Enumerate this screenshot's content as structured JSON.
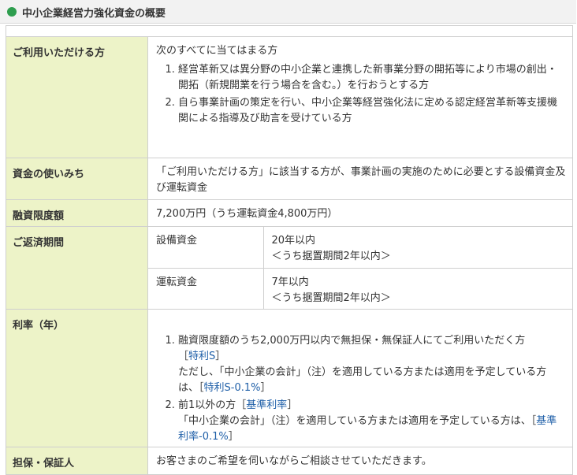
{
  "header": {
    "title": "中小企業経営力強化資金の概要"
  },
  "rows": {
    "eligibility": {
      "label": "ご利用いただける方",
      "intro": "次のすべてに当てはまる方",
      "items": [
        "経営革新又は異分野の中小企業と連携した新事業分野の開拓等により市場の創出・開拓（新規開業を行う場合を含む。）を行おうとする方",
        "自ら事業計画の策定を行い、中小企業等経営強化法に定める認定経営革新等支援機関による指導及び助言を受けている方"
      ]
    },
    "use": {
      "label": "資金の使いみち",
      "text": "「ご利用いただける方」に該当する方が、事業計画の実施のために必要とする設備資金及び運転資金"
    },
    "limit": {
      "label": "融資限度額",
      "text": "7,200万円（うち運転資金4,800万円）"
    },
    "repayment": {
      "label": "ご返済期間",
      "equipment": {
        "name": "設備資金",
        "term": "20年以内",
        "grace": "＜うち据置期間2年以内＞"
      },
      "operating": {
        "name": "運転資金",
        "term": "7年以内",
        "grace": "＜うち据置期間2年以内＞"
      }
    },
    "rate": {
      "label": "利率（年）",
      "item1": {
        "text": "融資限度額のうち2,000万円以内で無担保・無保証人にてご利用いただく方",
        "bracket_open": "［",
        "link": "特利S",
        "bracket_close": "］",
        "note": "ただし、「中小企業の会計」（注）を適用している方または適用を予定している方は、",
        "note_link": "特利S-0.1%",
        "note_close": "］"
      },
      "item2": {
        "text": "前1以外の方",
        "bracket_open": "［",
        "link": "基準利率",
        "bracket_close": "］",
        "note": "「中小企業の会計」（注）を適用している方または適用を予定している方は、",
        "note_link": "基準利率-0.1%",
        "note_close": "］"
      }
    },
    "collateral": {
      "label": "担保・保証人",
      "text": "お客さまのご希望を伺いながらご相談させていただきます。"
    }
  },
  "colors": {
    "label_bg": "#edf3c8",
    "header_dot": "#2e9e4f",
    "link": "#1f5fa8"
  }
}
